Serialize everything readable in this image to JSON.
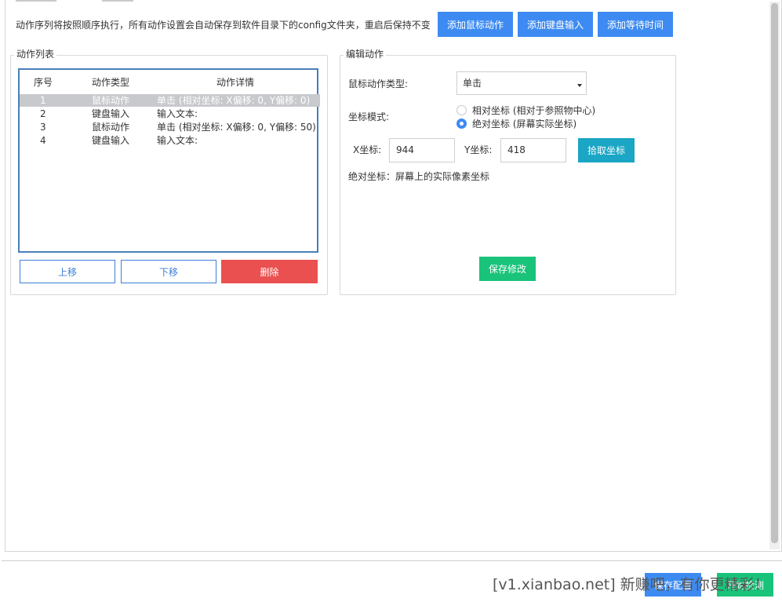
{
  "hint": "动作序列将按照顺序执行，所有动作设置会自动保存到软件目录下的config文件夹，重启后保持不变",
  "toolbar": {
    "add_mouse": "添加鼠标动作",
    "add_keyboard": "添加键盘输入",
    "add_wait": "添加等待时间"
  },
  "action_list": {
    "title": "动作列表",
    "columns": [
      "序号",
      "动作类型",
      "动作详情"
    ],
    "rows": [
      {
        "index": "1",
        "type": "鼠标动作",
        "detail": "单击 (相对坐标: X偏移: 0, Y偏移: 0)",
        "selected": true
      },
      {
        "index": "2",
        "type": "键盘输入",
        "detail": "输入文本:",
        "selected": false
      },
      {
        "index": "3",
        "type": "鼠标动作",
        "detail": "单击 (相对坐标: X偏移: 0, Y偏移: 50)",
        "selected": false
      },
      {
        "index": "4",
        "type": "键盘输入",
        "detail": "输入文本:",
        "selected": false
      }
    ],
    "move_up": "上移",
    "move_down": "下移",
    "delete": "删除"
  },
  "edit": {
    "title": "编辑动作",
    "mouse_type_label": "鼠标动作类型:",
    "mouse_type_value": "单击",
    "coord_mode_label": "坐标模式:",
    "radio_relative": "相对坐标 (相对于参照物中心)",
    "radio_absolute": "绝对坐标 (屏幕实际坐标)",
    "selected_mode": "absolute",
    "x_label": "X坐标:",
    "x_value": "944",
    "y_label": "Y坐标:",
    "y_value": "418",
    "pick_button": "拾取坐标",
    "help_text": "绝对坐标：屏幕上的实际像素坐标",
    "save_button": "保存修改"
  },
  "footer": {
    "save_config": "保存配置",
    "start_detect": "开始检测",
    "watermark": "[v1.xianbao.net] 新赚吧，有你更精彩！"
  },
  "colors": {
    "primary": "#3d8bf2",
    "teal": "#1aa6c4",
    "green": "#19c37a",
    "danger": "#e9504f",
    "selection": "#c7c9cc"
  }
}
